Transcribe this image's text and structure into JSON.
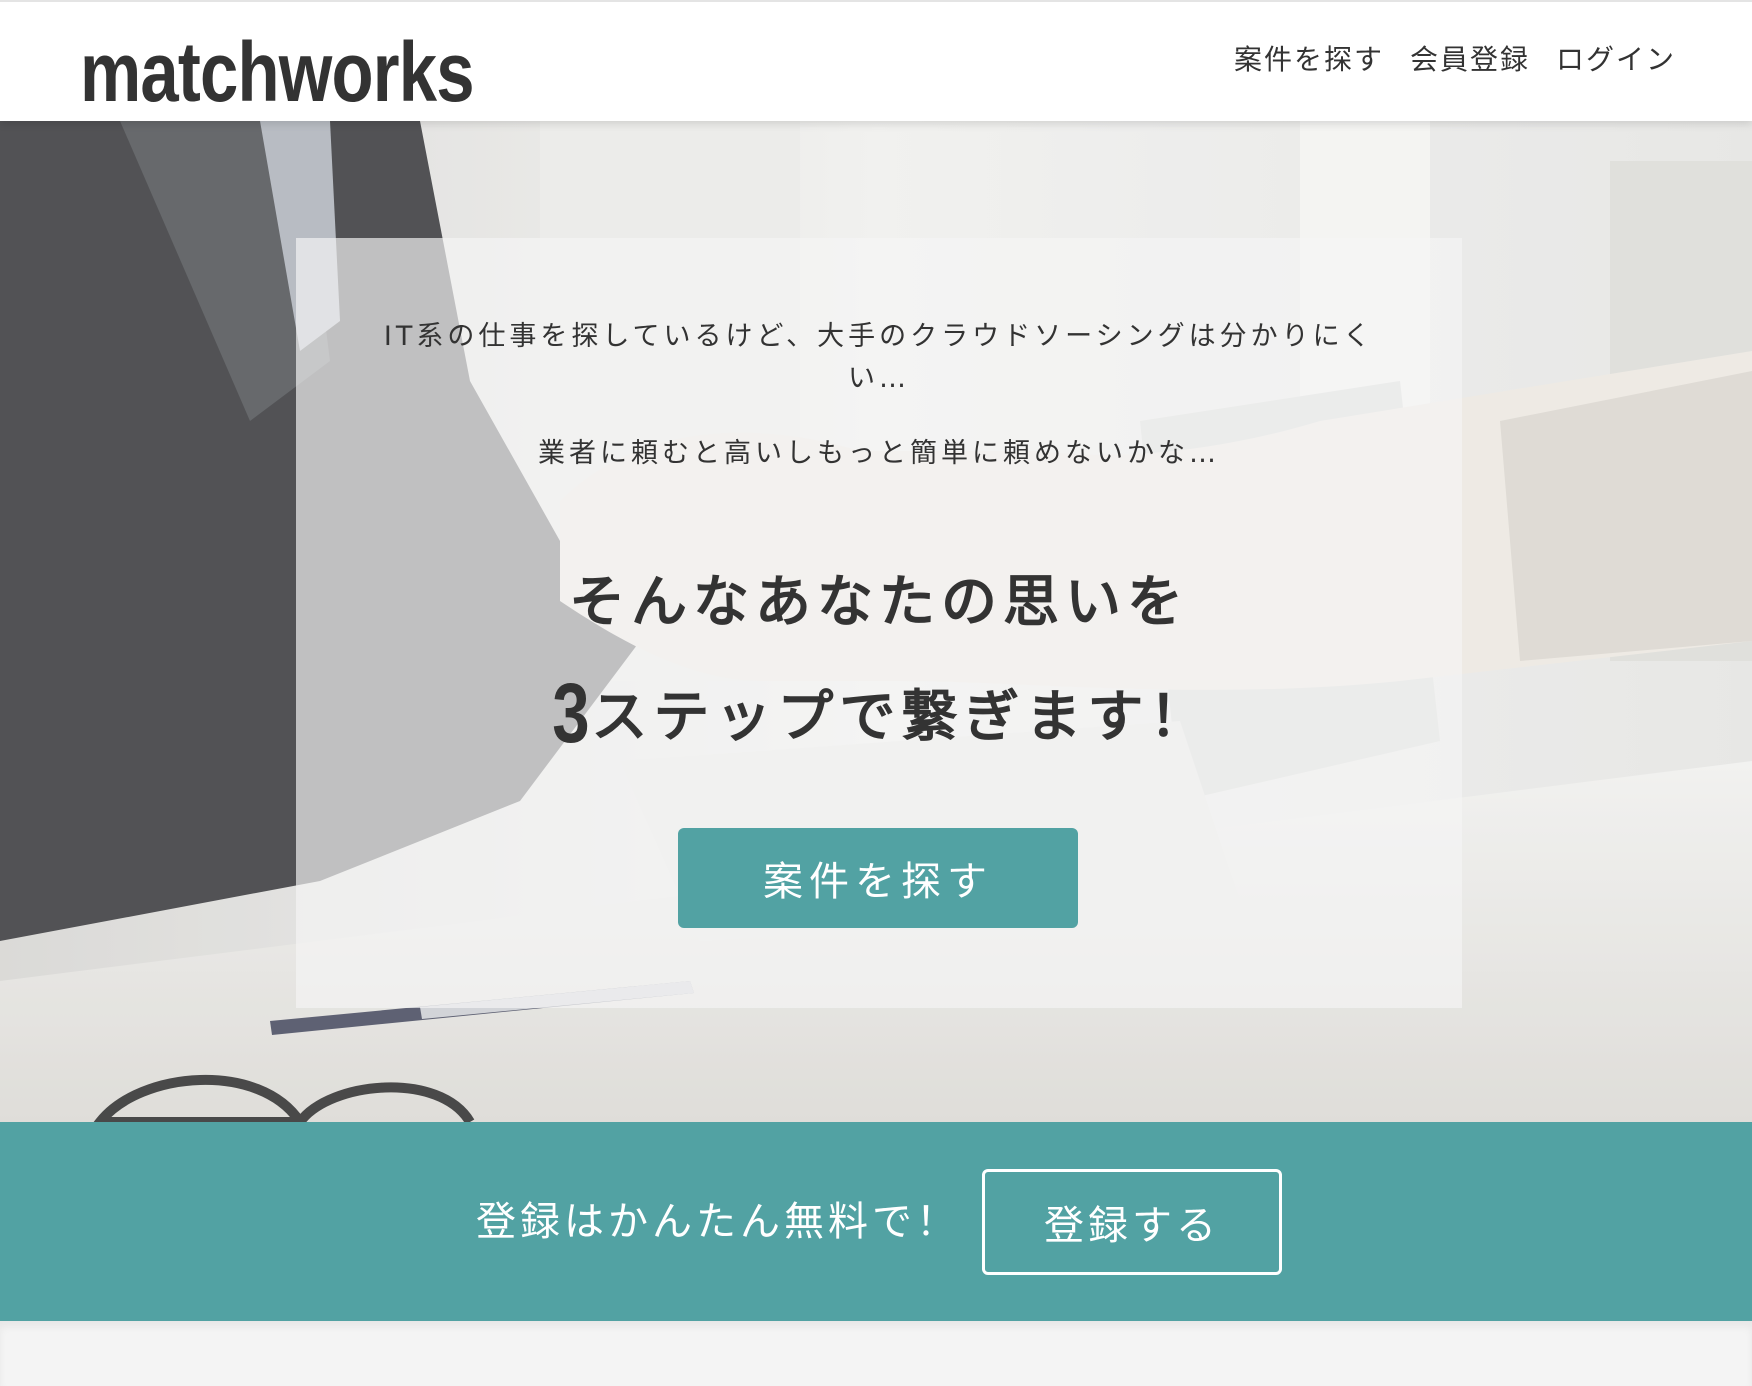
{
  "header": {
    "logo": "matchworks",
    "nav": [
      "案件を探す",
      "会員登録",
      "ログイン"
    ]
  },
  "hero": {
    "intro_line1": "IT系の仕事を探しているけど、大手のクラウドソーシングは分かりにくい…",
    "intro_line2": "業者に頼むと高いしもっと簡単に頼めないかな…",
    "headline_line1": "そんなあなたの思いを",
    "headline_number": "3",
    "headline_line2_rest": "ステップで繋ぎます！",
    "cta_label": "案件を探す",
    "background_image": "handshake-photo"
  },
  "register_band": {
    "text": "登録はかんたん無料で！",
    "button_label": "登録する"
  },
  "colors": {
    "accent": "#52a2a3",
    "text": "#333333",
    "header_bg": "#ffffff"
  }
}
